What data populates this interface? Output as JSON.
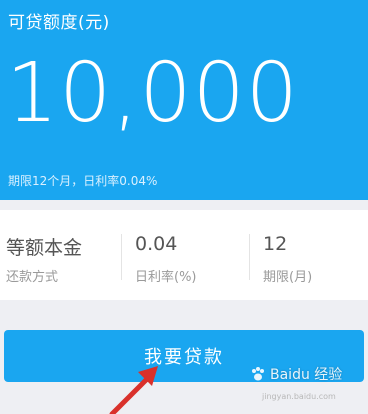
{
  "hero": {
    "title": "可贷额度(元)",
    "amount": "10,000",
    "note": "期限12个月，日利率0.04%"
  },
  "info": [
    {
      "value": "等额本金",
      "label": "还款方式"
    },
    {
      "value": "0.04",
      "label": "日利率(%)"
    },
    {
      "value": "12",
      "label": "期限(月)"
    }
  ],
  "action": {
    "label": "我要贷款"
  },
  "watermark": {
    "brand": "Baidu 经验",
    "url": "jingyan.baidu.com"
  },
  "colors": {
    "accent": "#1aa6f0",
    "arrow": "#d9312b"
  }
}
